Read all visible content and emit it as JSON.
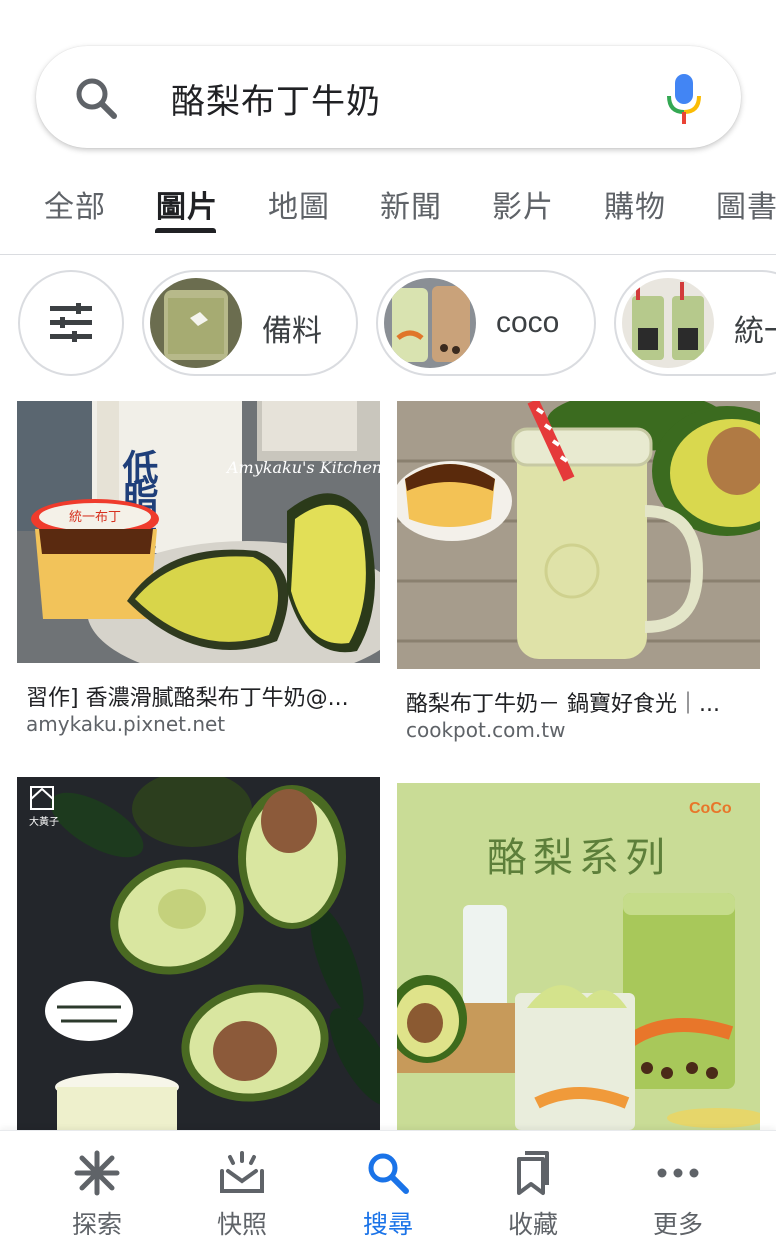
{
  "search": {
    "query": "酪梨布丁牛奶"
  },
  "tabs": [
    {
      "label": "全部"
    },
    {
      "label": "圖片"
    },
    {
      "label": "地圖"
    },
    {
      "label": "新聞"
    },
    {
      "label": "影片"
    },
    {
      "label": "購物"
    },
    {
      "label": "圖書"
    }
  ],
  "active_tab": "圖片",
  "chips": [
    {
      "label": "備料"
    },
    {
      "label": "coco"
    },
    {
      "label": "統一"
    }
  ],
  "results": [
    {
      "title": "習作] 香濃滑膩酪梨布丁牛奶@...",
      "source": "amykaku.pixnet.net",
      "overlay_text": "Amykaku's Kitchen",
      "pkg_text": "低脂肪鮮乳",
      "pudding_text": "統一布丁"
    },
    {
      "title": "酪梨布丁牛奶－ 鍋寶好食光｜...",
      "source": "cookpot.com.tw"
    },
    {
      "title": "",
      "source": "",
      "brand_text": "大黃子"
    },
    {
      "title": "",
      "source": "",
      "banner_text": "酪梨系列",
      "brand_text": "CoCo"
    }
  ],
  "bottom_nav": [
    {
      "label": "探索",
      "icon": "asterisk-icon"
    },
    {
      "label": "快照",
      "icon": "snapshot-icon"
    },
    {
      "label": "搜尋",
      "icon": "search-icon"
    },
    {
      "label": "收藏",
      "icon": "bookmarks-icon"
    },
    {
      "label": "更多",
      "icon": "more-dots-icon"
    }
  ],
  "colors": {
    "accent": "#1a73e8",
    "google_blue": "#4285f4",
    "google_red": "#ea4335",
    "google_yellow": "#fbbc04",
    "google_green": "#34a853"
  }
}
